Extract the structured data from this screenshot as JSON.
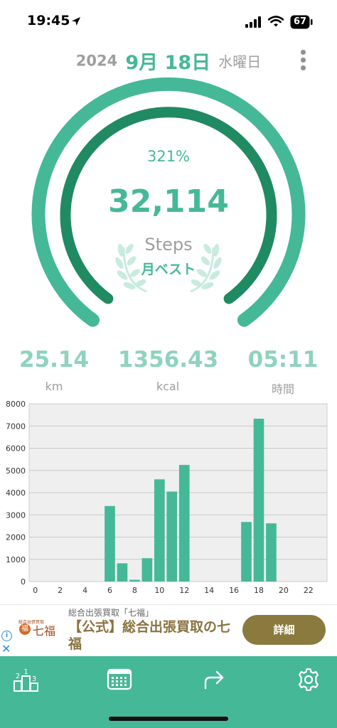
{
  "status_bar": {
    "time": "19:45",
    "battery": "67"
  },
  "header": {
    "year": "2024",
    "month_day": "9月 18日",
    "weekday": "水曜日"
  },
  "gauge": {
    "percent": "321%",
    "steps": "32,114",
    "steps_label": "Steps",
    "best_label": "月ベスト",
    "outer_color": "#45b898",
    "inner_color": "#208a63"
  },
  "stats": {
    "distance": {
      "value": "25.14",
      "unit": "km"
    },
    "calories": {
      "value": "1356.43",
      "unit": "kcal"
    },
    "duration": {
      "value": "05:11",
      "unit": "時間"
    }
  },
  "chart_data": {
    "type": "bar",
    "x_ticks": [
      "0",
      "2",
      "4",
      "6",
      "8",
      "10",
      "12",
      "14",
      "16",
      "18",
      "20",
      "22"
    ],
    "y_ticks": [
      "0",
      "1000",
      "2000",
      "3000",
      "4000",
      "5000",
      "6000",
      "7000",
      "8000"
    ],
    "ylim": [
      0,
      8000
    ],
    "xlim": [
      -0.5,
      23.5
    ],
    "bar_color": "#45b898",
    "hours": [
      6,
      7,
      8,
      9,
      10,
      11,
      12,
      17,
      18,
      19
    ],
    "values": [
      3400,
      820,
      80,
      1050,
      4600,
      4050,
      5250,
      2680,
      7330,
      2620
    ]
  },
  "ad": {
    "subtitle": "総合出張買取「七福」",
    "logo_small": "総合出張買取",
    "logo_mark": "福",
    "logo_text": "七福",
    "title": "【公式】総合出張買取の七福",
    "button": "詳細"
  },
  "bottom_nav": {
    "icons": [
      "ranking-icon",
      "calendar-icon",
      "share-icon",
      "settings-icon"
    ],
    "background": "#45b898"
  }
}
